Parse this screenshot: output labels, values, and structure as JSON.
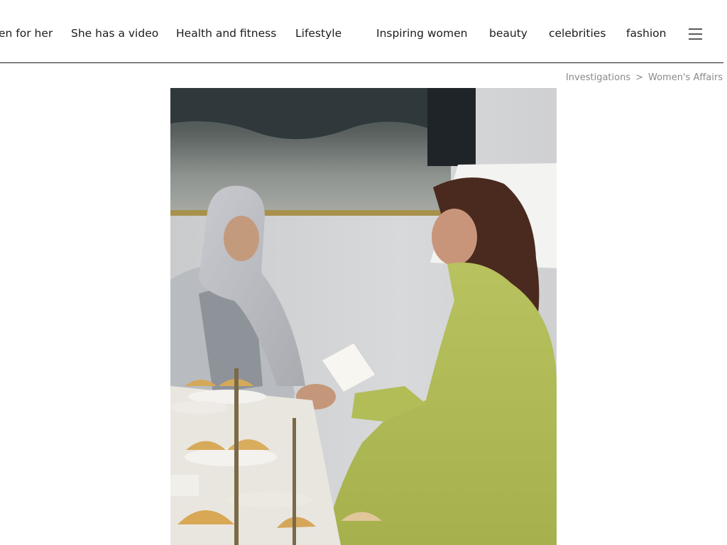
{
  "nav": {
    "items": [
      {
        "label": "en for her"
      },
      {
        "label": "She has a video"
      },
      {
        "label": "Health and fitness"
      },
      {
        "label": "Lifestyle"
      },
      {
        "label": "Inspiring women"
      },
      {
        "label": "beauty"
      },
      {
        "label": "celebrities"
      },
      {
        "label": "fashion"
      }
    ],
    "menu_icon": "hamburger-menu-icon"
  },
  "breadcrumb": {
    "items": [
      "Investigations",
      "Women's Affairs"
    ],
    "separator": ">"
  },
  "article": {
    "photo_icon": "article-photo"
  },
  "colors": {
    "nav_text": "#1c1c1c",
    "divider": "#1a1a1a",
    "breadcrumb": "#8a8a8a"
  }
}
